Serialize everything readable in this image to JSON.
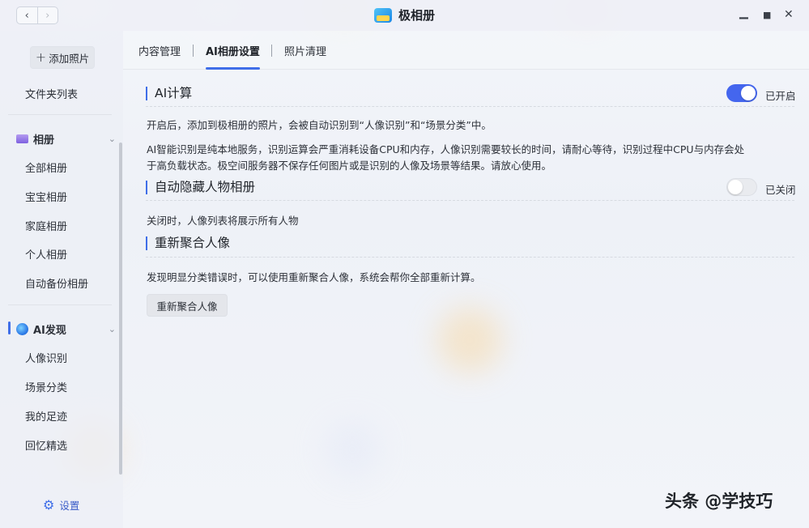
{
  "app": {
    "title": "极相册",
    "nav_back": "‹",
    "nav_forward": "›",
    "minimize": "▁",
    "maximize": "■",
    "close": "✕"
  },
  "sidebar": {
    "add_button": "添加照片",
    "folder_list": "文件夹列表",
    "albums_group": "相册",
    "albums": [
      "全部相册",
      "宝宝相册",
      "家庭相册",
      "个人相册",
      "自动备份相册"
    ],
    "ai_group": "AI发现",
    "ai_items": [
      "人像识别",
      "场景分类",
      "我的足迹",
      "回忆精选"
    ],
    "settings": "设置",
    "chevron": "⌄"
  },
  "tabs": [
    "内容管理",
    "AI相册设置",
    "照片清理"
  ],
  "active_tab": "AI相册设置",
  "sections": {
    "ai_compute": {
      "title": "AI计算",
      "toggle_state": "已开启",
      "desc1": "开启后，添加到极相册的照片，会被自动识别到“人像识别”和“场景分类”中。",
      "desc2": "AI智能识别是纯本地服务，识别运算会严重消耗设备CPU和内存，人像识别需要较长的时间，请耐心等待，识别过程中CPU与内存会处",
      "desc3": "于高负载状态。极空间服务器不保存任何图片或是识别的人像及场景等结果。请放心使用。"
    },
    "auto_hide": {
      "title": "自动隐藏人物相册",
      "toggle_state": "已关闭",
      "desc": "关闭时，人像列表将展示所有人物"
    },
    "regroup": {
      "title": "重新聚合人像",
      "desc": "发现明显分类错误时，可以使用重新聚合人像，系统会帮你全部重新计算。",
      "button": "重新聚合人像"
    }
  },
  "watermark": "头条 @学技巧",
  "colors": {
    "accent": "#4466ee",
    "text": "#2d3139"
  }
}
